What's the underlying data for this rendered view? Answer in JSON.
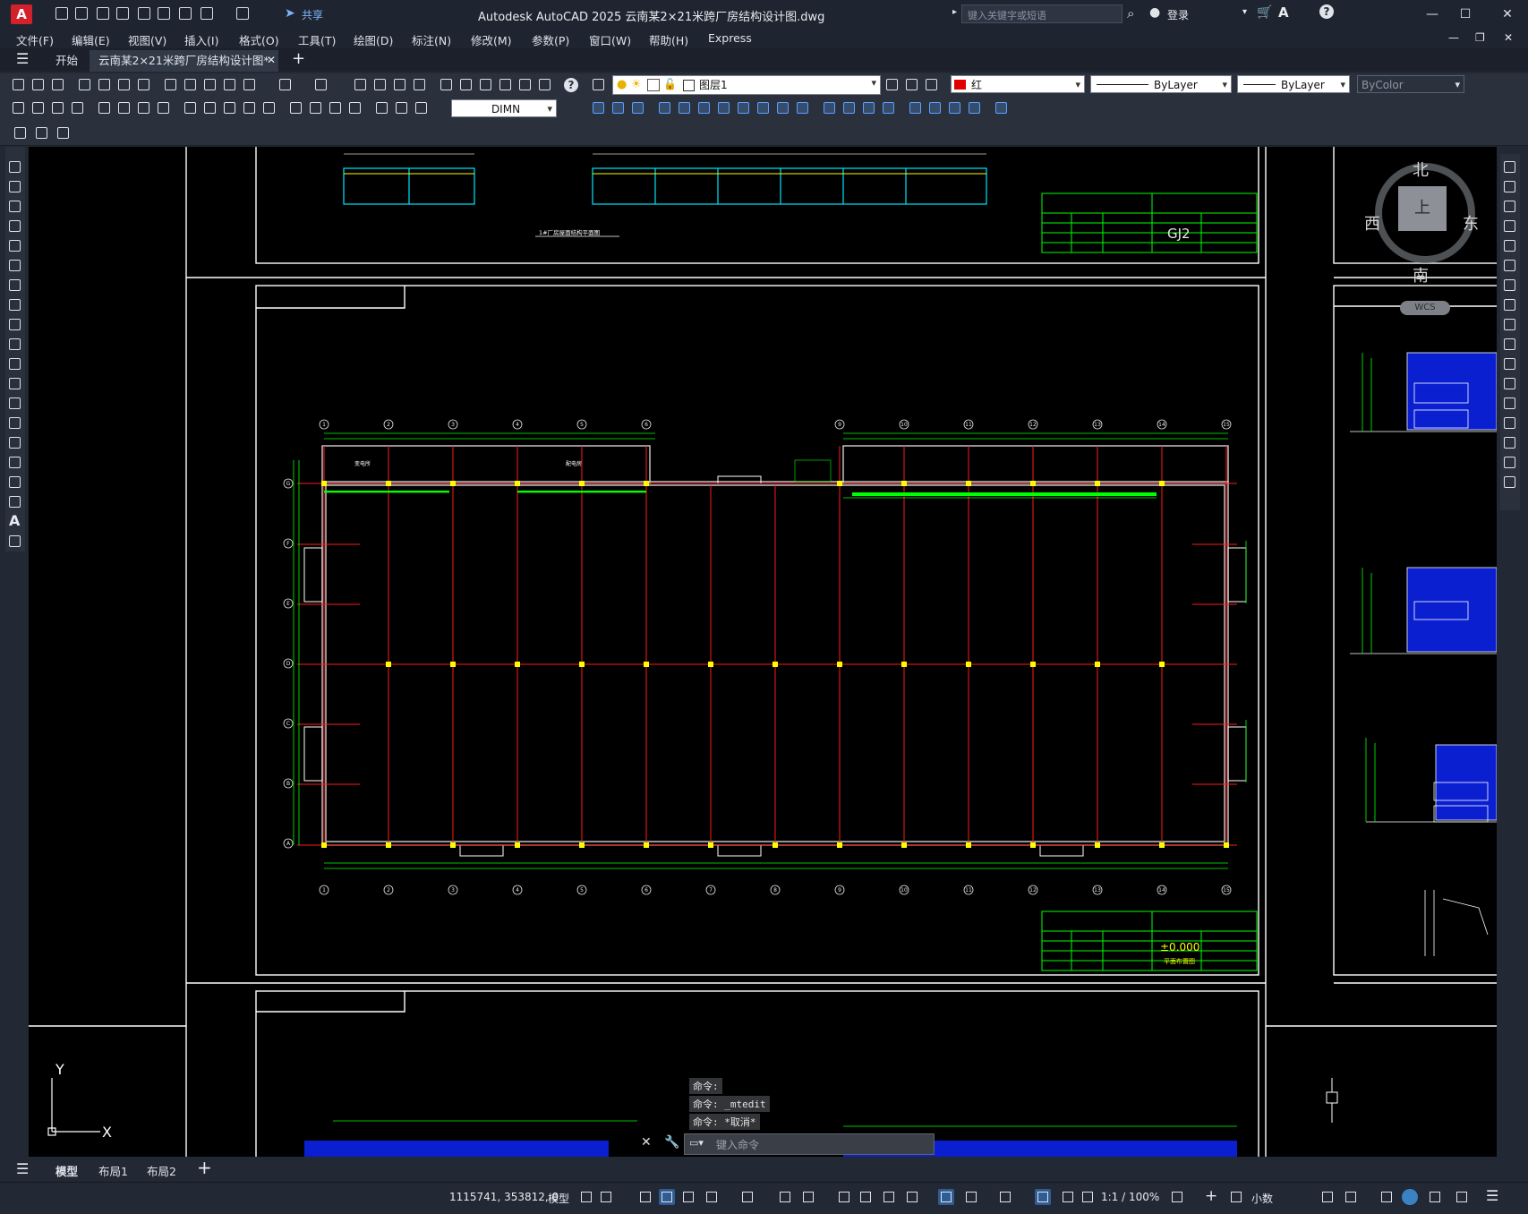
{
  "app": {
    "logo_letter": "A",
    "share_label": "共享",
    "window_title": "Autodesk AutoCAD 2025    云南某2×21米跨厂房结构设计图.dwg",
    "search_placeholder": "键入关键字或短语",
    "login_label": "登录"
  },
  "menu": [
    "文件(F)",
    "编辑(E)",
    "视图(V)",
    "插入(I)",
    "格式(O)",
    "工具(T)",
    "绘图(D)",
    "标注(N)",
    "修改(M)",
    "参数(P)",
    "窗口(W)",
    "帮助(H)",
    "Express"
  ],
  "tabs": {
    "start": "开始",
    "document": "云南某2×21米跨厂房结构设计图*"
  },
  "toolbar": {
    "layer_name": "图层1",
    "color_name": "红",
    "color_swatch": "#e00000",
    "linetype": "ByLayer",
    "lineweight": "ByLayer",
    "plotstyle": "ByColor",
    "dimstyle": "DIMN"
  },
  "viewcube": {
    "north": "北",
    "south": "南",
    "west": "西",
    "east": "东",
    "top": "上",
    "wcs": "WCS"
  },
  "ucs": {
    "x": "X",
    "y": "Y"
  },
  "drawing": {
    "title_block_top": "GJ2",
    "title_block_main": "±0.000",
    "title_block_main_sub": "平面布置图",
    "plan_caption": "1#厂房屋面结构平面图",
    "axis_numbers": [
      "1",
      "2",
      "3",
      "4",
      "5",
      "6",
      "7",
      "8",
      "9",
      "10",
      "11",
      "12",
      "13",
      "14",
      "15"
    ],
    "axis_letters": [
      "G",
      "F",
      "E",
      "D",
      "C",
      "B",
      "A"
    ],
    "room_labels": [
      "变电所",
      "配电房"
    ]
  },
  "command": {
    "history": [
      "命令:",
      "命令: _mtedit",
      "命令: *取消*"
    ],
    "input_placeholder": "键入命令"
  },
  "layouts": [
    "模型",
    "布局1",
    "布局2"
  ],
  "status": {
    "coordinates": "1115741, 353812, 0",
    "space": "模型",
    "scale": "1:1 / 100%",
    "units": "小数"
  }
}
